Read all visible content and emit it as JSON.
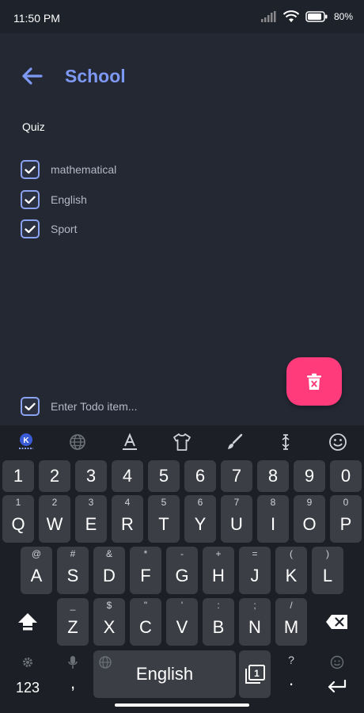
{
  "status": {
    "time": "11:50 PM",
    "battery": "80%"
  },
  "header": {
    "title": "School"
  },
  "section_title": "Quiz",
  "todos": [
    {
      "label": "mathematical",
      "checked": true
    },
    {
      "label": "English",
      "checked": true
    },
    {
      "label": "Sport",
      "checked": true
    }
  ],
  "input": {
    "placeholder": "Enter Todo item..."
  },
  "colors": {
    "accent": "#7e99f4",
    "fab": "#ff3b7b",
    "background": "#232833"
  },
  "keyboard": {
    "numbers": [
      "1",
      "2",
      "3",
      "4",
      "5",
      "6",
      "7",
      "8",
      "9",
      "0"
    ],
    "row1": [
      {
        "k": "Q",
        "h": "1"
      },
      {
        "k": "W",
        "h": "2"
      },
      {
        "k": "E",
        "h": "3"
      },
      {
        "k": "R",
        "h": "4"
      },
      {
        "k": "T",
        "h": "5"
      },
      {
        "k": "Y",
        "h": "6"
      },
      {
        "k": "U",
        "h": "7"
      },
      {
        "k": "I",
        "h": "8"
      },
      {
        "k": "O",
        "h": "9"
      },
      {
        "k": "P",
        "h": "0"
      }
    ],
    "row2": [
      {
        "k": "A",
        "h": "@"
      },
      {
        "k": "S",
        "h": "#"
      },
      {
        "k": "D",
        "h": "&"
      },
      {
        "k": "F",
        "h": "*"
      },
      {
        "k": "G",
        "h": "-"
      },
      {
        "k": "H",
        "h": "+"
      },
      {
        "k": "J",
        "h": "="
      },
      {
        "k": "K",
        "h": "("
      },
      {
        "k": "L",
        "h": ")"
      }
    ],
    "row3": [
      {
        "k": "Z",
        "h": "_"
      },
      {
        "k": "X",
        "h": "$"
      },
      {
        "k": "C",
        "h": "\""
      },
      {
        "k": "V",
        "h": "'"
      },
      {
        "k": "B",
        "h": ":"
      },
      {
        "k": "N",
        "h": ";"
      },
      {
        "k": "M",
        "h": "/"
      }
    ],
    "symbols_label": "123",
    "comma": ",",
    "period": ".",
    "period_hint": "?",
    "space_label": "English",
    "clipboard_number": "1"
  }
}
